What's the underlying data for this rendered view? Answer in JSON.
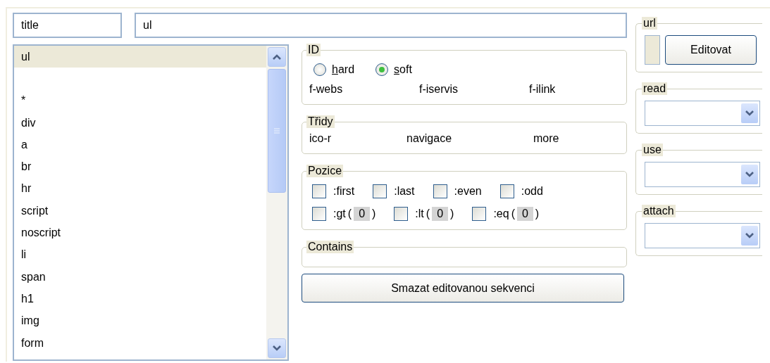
{
  "title_field": {
    "value": "title"
  },
  "selector_field": {
    "value": "ul"
  },
  "element_list": {
    "items": [
      {
        "kind": "tag",
        "label": "ul",
        "selected": true
      },
      {
        "kind": "blank"
      },
      {
        "kind": "tag",
        "label": "*",
        "selected": false
      },
      {
        "kind": "tag",
        "label": "div",
        "selected": false
      },
      {
        "kind": "tag",
        "label": "a",
        "selected": false
      },
      {
        "kind": "tag",
        "label": "br",
        "selected": false
      },
      {
        "kind": "tag",
        "label": "hr",
        "selected": false
      },
      {
        "kind": "tag",
        "label": "script",
        "selected": false
      },
      {
        "kind": "tag",
        "label": "noscript",
        "selected": false
      },
      {
        "kind": "tag",
        "label": "li",
        "selected": false
      },
      {
        "kind": "tag",
        "label": "span",
        "selected": false
      },
      {
        "kind": "tag",
        "label": "h1",
        "selected": false
      },
      {
        "kind": "tag",
        "label": "img",
        "selected": false
      },
      {
        "kind": "tag",
        "label": "form",
        "selected": false
      }
    ]
  },
  "id_group": {
    "legend": "ID",
    "radios": [
      {
        "label": "hard",
        "selected": false
      },
      {
        "label": "soft",
        "selected": true
      }
    ],
    "values": [
      "f-webs",
      "f-iservis",
      "f-ilink"
    ]
  },
  "classes_group": {
    "legend": "Třidy",
    "values": [
      "ico-r",
      "navigace",
      "more"
    ]
  },
  "position_group": {
    "legend": "Pozice",
    "options": [
      {
        "kind": "plain",
        "label": ":first",
        "checked": false
      },
      {
        "kind": "plain",
        "label": ":last",
        "checked": false
      },
      {
        "kind": "plain",
        "label": ":even",
        "checked": false
      },
      {
        "kind": "plain",
        "label": ":odd",
        "checked": false
      },
      {
        "kind": "number",
        "label": ":gt",
        "checked": false,
        "open": "(",
        "value": "0",
        "close": ")"
      },
      {
        "kind": "number",
        "label": ":lt",
        "checked": false,
        "open": "(",
        "value": "0",
        "close": ")"
      },
      {
        "kind": "number",
        "label": ":eq",
        "checked": false,
        "open": "(",
        "value": "0",
        "close": ")"
      }
    ]
  },
  "contains_group": {
    "legend": "Contains"
  },
  "clear_button": {
    "label": "Smazat editovanou sekvenci"
  },
  "url_group": {
    "legend": "url",
    "button": "Editovat"
  },
  "dropdowns": [
    {
      "legend": "read"
    },
    {
      "legend": "use"
    },
    {
      "legend": "attach"
    }
  ]
}
